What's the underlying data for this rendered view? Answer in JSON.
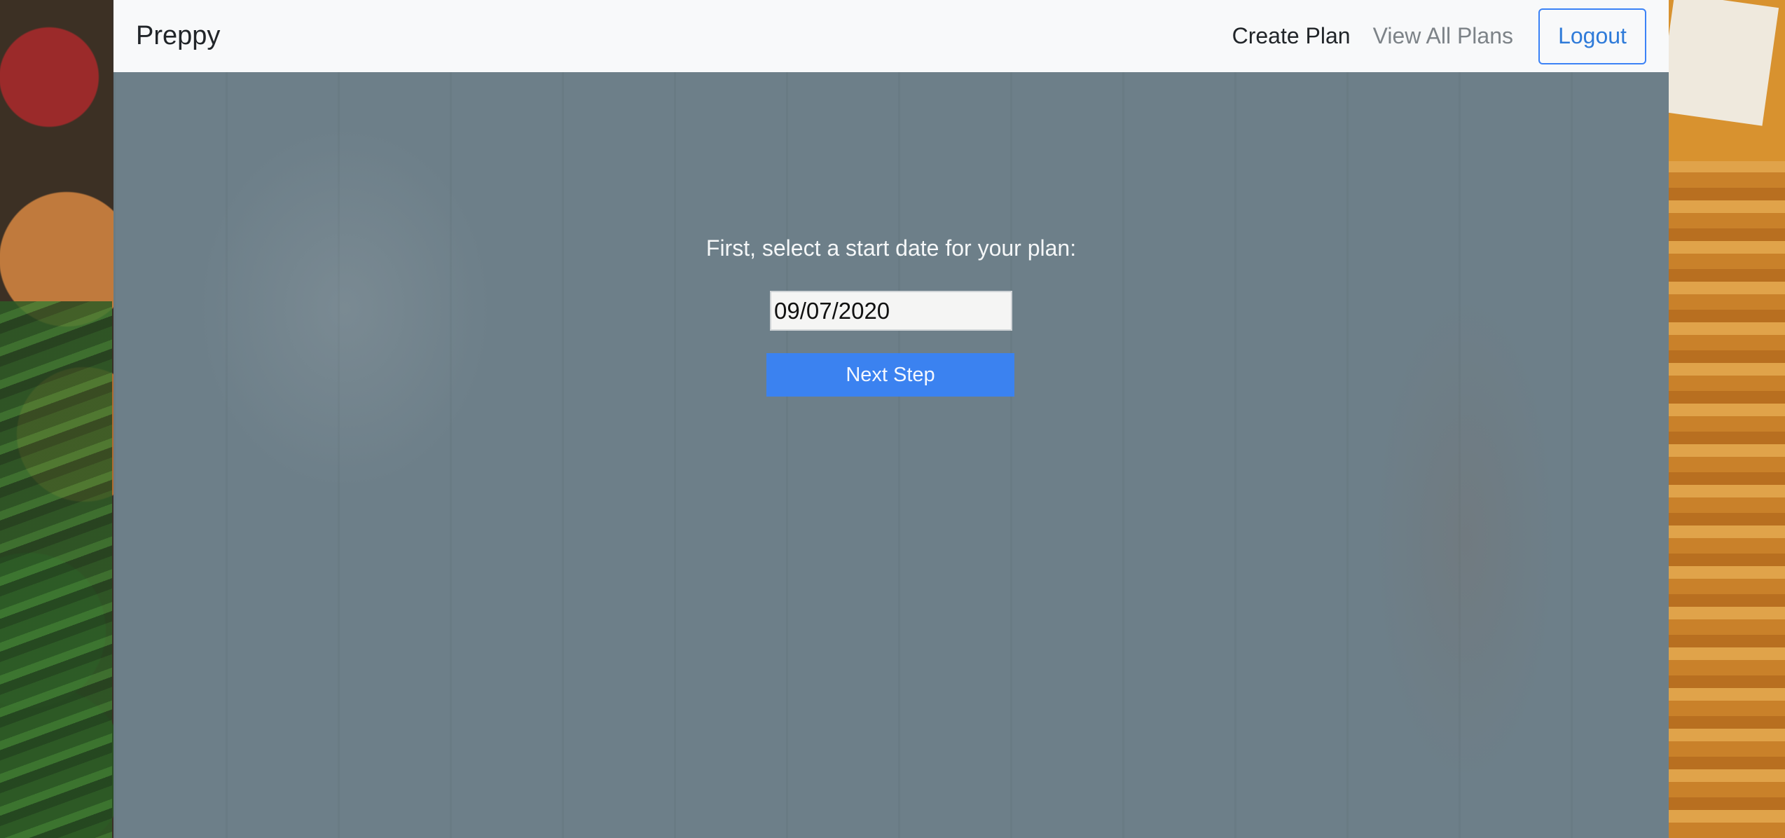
{
  "navbar": {
    "brand": "Preppy",
    "links": [
      {
        "label": "Create Plan"
      },
      {
        "label": "View All Plans"
      }
    ],
    "logout_label": "Logout"
  },
  "form": {
    "prompt": "First, select a start date for your plan:",
    "date_value": "09/07/2020",
    "submit_label": "Next Step"
  },
  "colors": {
    "accent": "#3b82f0",
    "navbar_bg": "#f8f9fa",
    "panel_bg": "#6d7f89"
  }
}
